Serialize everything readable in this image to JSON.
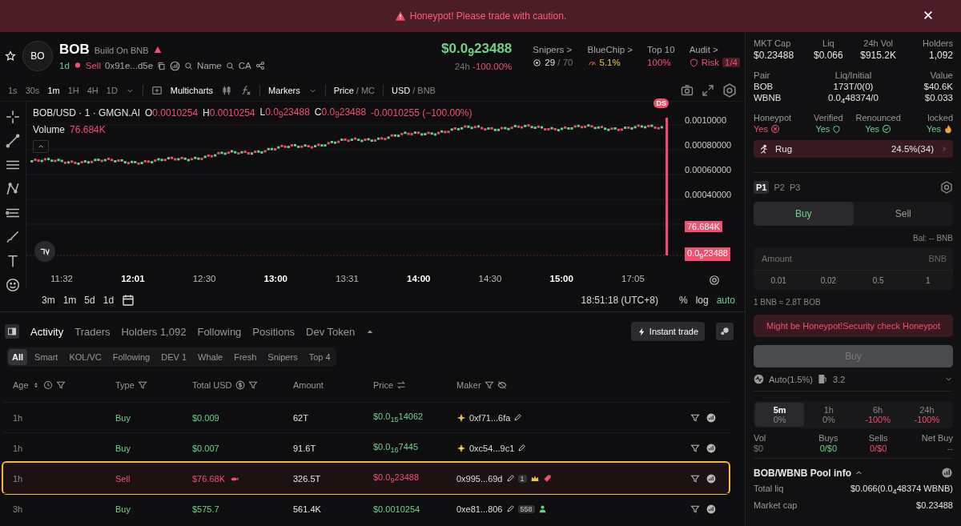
{
  "banner": {
    "text": "Honeypot! Please trade with caution."
  },
  "token": {
    "avatar": "BO",
    "symbol": "BOB",
    "chain": "Build On BNB",
    "age": "1d",
    "tag": "Sell",
    "address": "0x91e...d5e",
    "links": [
      "Name",
      "CA"
    ]
  },
  "price": {
    "value": "$0.0$_{9}$23488",
    "period": "24h",
    "change": "-100.00%"
  },
  "stats": [
    {
      "label": "Snipers >",
      "value": "29",
      "extra": "/ 70",
      "kind": "snipers"
    },
    {
      "label": "BlueChip >",
      "value": "5.1%",
      "kind": "bluechip"
    },
    {
      "label": "Top 10",
      "value": "100%",
      "kind": "plain"
    },
    {
      "label": "Audit >",
      "value": "Risk",
      "extra": "1/4",
      "kind": "risk"
    }
  ],
  "toolbar": {
    "intervals": [
      {
        "label": "1s",
        "selected": false
      },
      {
        "label": "30s",
        "selected": false
      },
      {
        "label": "1m",
        "selected": true
      },
      {
        "label": "1H",
        "selected": false
      },
      {
        "label": "4H",
        "selected": false
      },
      {
        "label": "1D",
        "selected": false
      }
    ],
    "multicharts": "Multicharts",
    "markers": "Markers",
    "separator": "/",
    "price_mode": [
      {
        "label": "Price",
        "selected": true
      },
      {
        "label": "MC",
        "selected": false
      }
    ],
    "currency": [
      {
        "label": "USD",
        "selected": true
      },
      {
        "label": "BNB",
        "selected": false
      }
    ]
  },
  "chart": {
    "legend": "BOB/USD · 1 · GMGN.AI",
    "ohlc": [
      {
        "key": "O",
        "value": "0.0010254"
      },
      {
        "key": "H",
        "value": "0.0010254"
      },
      {
        "key": "L",
        "value": "0.0$_{9}$23488"
      },
      {
        "key": "C",
        "value": "0.0$_{9}$23488"
      }
    ],
    "change": "-0.0010255 (−100.00%)",
    "volume_label": "Volume",
    "volume": "76.684K",
    "marker": "DS",
    "price_labels": [
      "0.0010000",
      "0.00080000",
      "0.00060000",
      "0.00040000"
    ],
    "volume_tag": "76.684K",
    "last_tag": "0.0$_{9}$23488",
    "time_labels": [
      {
        "label": "11:32",
        "major": false
      },
      {
        "label": "12:01",
        "major": true
      },
      {
        "label": "12:30",
        "major": false
      },
      {
        "label": "13:00",
        "major": true
      },
      {
        "label": "13:31",
        "major": false
      },
      {
        "label": "14:00",
        "major": true
      },
      {
        "label": "14:30",
        "major": false
      },
      {
        "label": "15:00",
        "major": true
      },
      {
        "label": "17:05",
        "major": false
      }
    ]
  },
  "chart_footer": {
    "ranges": [
      "3m",
      "1m",
      "5d",
      "1d"
    ],
    "clock": "18:51:18 (UTC+8)",
    "options": [
      {
        "label": "%",
        "on": false
      },
      {
        "label": "log",
        "on": false
      },
      {
        "label": "auto",
        "on": true
      }
    ]
  },
  "tabs": [
    {
      "label": "Activity",
      "selected": true
    },
    {
      "label": "Traders",
      "selected": false
    },
    {
      "label": "Holders 1,092",
      "selected": false
    },
    {
      "label": "Following",
      "selected": false
    },
    {
      "label": "Positions",
      "selected": false
    },
    {
      "label": "Dev Token",
      "selected": false
    }
  ],
  "instant_trade": "Instant trade",
  "filters": [
    {
      "label": "All",
      "selected": true
    },
    {
      "label": "Smart",
      "selected": false
    },
    {
      "label": "KOL/VC",
      "selected": false
    },
    {
      "label": "Following",
      "selected": false
    },
    {
      "label": "DEV 1",
      "selected": false
    },
    {
      "label": "Whale",
      "selected": false
    },
    {
      "label": "Fresh",
      "selected": false
    },
    {
      "label": "Snipers",
      "selected": false
    },
    {
      "label": "Top 4",
      "selected": false
    }
  ],
  "table": {
    "columns": [
      "Age",
      "Type",
      "Total USD",
      "Amount",
      "Price",
      "Maker"
    ],
    "rows": [
      {
        "age": "1h",
        "type": "Buy",
        "kind": "buy",
        "total": "$0.009",
        "amount": "62T",
        "price": "$0.0$_{15}$14062",
        "maker": "0xf71...6fa",
        "maker_tags": [
          {
            "kind": "sparkle"
          }
        ],
        "highlighted": false
      },
      {
        "age": "1h",
        "type": "Buy",
        "kind": "buy",
        "total": "$0.007",
        "amount": "91.6T",
        "price": "$0.0$_{16}$7445",
        "maker": "0xc54...9c1",
        "maker_tags": [
          {
            "kind": "sparkle"
          }
        ],
        "highlighted": false
      },
      {
        "age": "1h",
        "type": "Sell",
        "kind": "sell",
        "total": "$76.68K",
        "amount": "326.5T",
        "price": "$0.0$_{9}$23488",
        "maker": "0x995...69d",
        "badge": "1",
        "maker_tags": [
          {
            "kind": "crown"
          },
          {
            "kind": "tag"
          }
        ],
        "highlighted": true
      },
      {
        "age": "3h",
        "type": "Buy",
        "kind": "buy",
        "total": "$575.7",
        "amount": "561.4K",
        "price": "$0.0010254",
        "maker": "0xe81...806",
        "badge": "558",
        "maker_tags": [
          {
            "kind": "person"
          }
        ],
        "highlighted": false
      }
    ]
  },
  "market": [
    {
      "label": "MKT Cap",
      "value": "$0.23488"
    },
    {
      "label": "Liq",
      "value": "$0.066"
    },
    {
      "label": "24h Vol",
      "value": "$915.2K"
    },
    {
      "label": "Holders",
      "value": "1,092"
    }
  ],
  "pair": {
    "headers": [
      "Pair",
      "Liq/Initial",
      "Value"
    ],
    "rows": [
      [
        "BOB",
        "173T/0(0)",
        "$40.6K"
      ],
      [
        "WBNB",
        "0.0$_{4}$48374/0",
        "$0.033"
      ]
    ]
  },
  "audit": [
    {
      "label": "Honeypot",
      "value": "Yes",
      "ok": false,
      "kind": "cross"
    },
    {
      "label": "Verified",
      "value": "Yes",
      "ok": true,
      "kind": "shield"
    },
    {
      "label": "Renounced",
      "value": "Yes",
      "ok": true,
      "kind": "check"
    },
    {
      "label": "locked",
      "value": "Yes",
      "ok": true,
      "kind": "flame"
    }
  ],
  "rug": {
    "label": "Rug",
    "value": "24.5%(34)"
  },
  "presets": [
    {
      "label": "P1",
      "selected": true
    },
    {
      "label": "P2",
      "selected": false
    },
    {
      "label": "P3",
      "selected": false
    }
  ],
  "sides": [
    {
      "label": "Buy",
      "selected": true
    },
    {
      "label": "Sell",
      "selected": false
    }
  ],
  "balance": "Bal: -- BNB",
  "amount": {
    "placeholder": "Amount",
    "unit": "BNB"
  },
  "quick": [
    "0.01",
    "0.02",
    "0.5",
    "1"
  ],
  "rate": "1 BNB ≈ 2.8T BOB",
  "warning": "Might be Honeypot!Security check Honeypot",
  "buy_button": {
    "label": "Buy",
    "disabled": true
  },
  "slippage": "Auto(1.5%)",
  "gas": "3.2",
  "periods": [
    {
      "label": "5m",
      "change": "0%",
      "selected": true,
      "kind": "flat"
    },
    {
      "label": "1h",
      "change": "0%",
      "selected": false,
      "kind": "flat"
    },
    {
      "label": "6h",
      "change": "-100%",
      "selected": false,
      "kind": "down"
    },
    {
      "label": "24h",
      "change": "-100%",
      "selected": false,
      "kind": "down"
    }
  ],
  "flow": [
    {
      "label": "Vol",
      "value": "$0",
      "kind": "neutral"
    },
    {
      "label": "Buys",
      "value": "0/$0",
      "kind": "buy"
    },
    {
      "label": "Sells",
      "value": "0/$0",
      "kind": "sell"
    },
    {
      "label": "Net Buy",
      "value": "--",
      "kind": "neutral"
    }
  ],
  "pool": {
    "title": "BOB/WBNB Pool info",
    "rows": [
      {
        "label": "Total liq",
        "value": "$0.066(0.0$_{4}$48374 WBNB)"
      },
      {
        "label": "Market cap",
        "value": "$0.23488"
      }
    ]
  }
}
